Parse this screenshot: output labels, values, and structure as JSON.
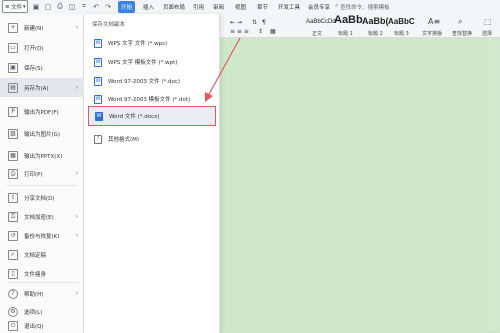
{
  "toolbar": {
    "file_label": "文件",
    "tabs": [
      {
        "label": "开始",
        "active": true
      },
      {
        "label": "插入",
        "active": false
      },
      {
        "label": "页面布局",
        "active": false
      },
      {
        "label": "引用",
        "active": false
      },
      {
        "label": "审阅",
        "active": false
      },
      {
        "label": "视图",
        "active": false
      },
      {
        "label": "章节",
        "active": false
      },
      {
        "label": "开发工具",
        "active": false
      },
      {
        "label": "会员专享",
        "active": false
      }
    ],
    "search_placeholder": "查找命令、搜索模板",
    "styles": [
      {
        "sample": "AaBbCcDd",
        "label": "正文"
      },
      {
        "sample": "AaBb",
        "label": "标题 1"
      },
      {
        "sample": "AaBb(",
        "label": "标题 2"
      },
      {
        "sample": "AaBbC",
        "label": "标题 3"
      }
    ],
    "text_tools_label": "文字排版",
    "find_replace_label": "查找替换",
    "select_label": "选择"
  },
  "file_panel": {
    "items": [
      {
        "label": "新建(N)",
        "icon": "new-icon",
        "has_arrow": true
      },
      {
        "label": "打开(O)",
        "icon": "open-folder-icon",
        "has_arrow": false
      },
      {
        "label": "保存(S)",
        "icon": "save-icon",
        "has_arrow": false
      },
      {
        "label": "另存为(A)",
        "icon": "save-as-icon",
        "has_arrow": true,
        "selected": true
      },
      {
        "label": "输出为PDF(F)",
        "icon": "pdf-icon",
        "has_arrow": false
      },
      {
        "label": "输出为图片(G)",
        "icon": "image-icon",
        "has_arrow": false
      },
      {
        "label": "输出为PPTX(X)",
        "icon": "pptx-icon",
        "has_arrow": false
      },
      {
        "label": "打印(P)",
        "icon": "print-icon",
        "has_arrow": true
      },
      {
        "label": "分享文档(D)",
        "icon": "share-icon",
        "has_arrow": false
      },
      {
        "label": "文档加密(E)",
        "icon": "lock-icon",
        "has_arrow": true
      },
      {
        "label": "备份与恢复(K)",
        "icon": "backup-icon",
        "has_arrow": true
      },
      {
        "label": "文档定稿",
        "icon": "finalize-icon",
        "has_arrow": false
      },
      {
        "label": "文件瘦身",
        "icon": "slim-icon",
        "has_arrow": false
      },
      {
        "label": "帮助(H)",
        "icon": "help-icon",
        "has_arrow": true
      },
      {
        "label": "选项(L)",
        "icon": "options-icon",
        "has_arrow": false
      },
      {
        "label": "退出(Q)",
        "icon": "exit-icon",
        "has_arrow": false
      }
    ]
  },
  "save_as_menu": {
    "title": "保存文档副本",
    "items": [
      {
        "label": "WPS 文字 文件 (*.wps)",
        "icon": "wps-doc-icon"
      },
      {
        "label": "WPS 文字 模板文件 (*.wpt)",
        "icon": "wps-template-icon"
      },
      {
        "label": "Word 97-2003 文件 (*.doc)",
        "icon": "word-doc-icon"
      },
      {
        "label": "Word 97-2003 模板文件 (*.dot)",
        "icon": "word-template-icon"
      },
      {
        "label": "Word 文件 (*.docx)",
        "icon": "word-docx-icon",
        "highlighted": true
      },
      {
        "label": "其他格式(M)",
        "icon": "other-format-icon"
      }
    ]
  },
  "colors": {
    "accent": "#3b82e8",
    "highlight_border": "#e8575c",
    "document_background": "#cfe8c9"
  }
}
